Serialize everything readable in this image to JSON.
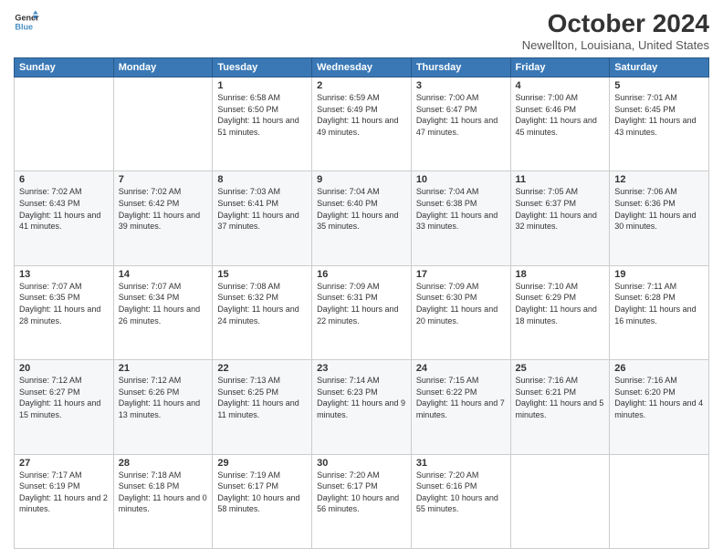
{
  "logo": {
    "line1": "General",
    "line2": "Blue"
  },
  "header": {
    "month": "October 2024",
    "location": "Newellton, Louisiana, United States"
  },
  "weekdays": [
    "Sunday",
    "Monday",
    "Tuesday",
    "Wednesday",
    "Thursday",
    "Friday",
    "Saturday"
  ],
  "weeks": [
    [
      {
        "day": "",
        "info": ""
      },
      {
        "day": "",
        "info": ""
      },
      {
        "day": "1",
        "info": "Sunrise: 6:58 AM\nSunset: 6:50 PM\nDaylight: 11 hours and 51 minutes."
      },
      {
        "day": "2",
        "info": "Sunrise: 6:59 AM\nSunset: 6:49 PM\nDaylight: 11 hours and 49 minutes."
      },
      {
        "day": "3",
        "info": "Sunrise: 7:00 AM\nSunset: 6:47 PM\nDaylight: 11 hours and 47 minutes."
      },
      {
        "day": "4",
        "info": "Sunrise: 7:00 AM\nSunset: 6:46 PM\nDaylight: 11 hours and 45 minutes."
      },
      {
        "day": "5",
        "info": "Sunrise: 7:01 AM\nSunset: 6:45 PM\nDaylight: 11 hours and 43 minutes."
      }
    ],
    [
      {
        "day": "6",
        "info": "Sunrise: 7:02 AM\nSunset: 6:43 PM\nDaylight: 11 hours and 41 minutes."
      },
      {
        "day": "7",
        "info": "Sunrise: 7:02 AM\nSunset: 6:42 PM\nDaylight: 11 hours and 39 minutes."
      },
      {
        "day": "8",
        "info": "Sunrise: 7:03 AM\nSunset: 6:41 PM\nDaylight: 11 hours and 37 minutes."
      },
      {
        "day": "9",
        "info": "Sunrise: 7:04 AM\nSunset: 6:40 PM\nDaylight: 11 hours and 35 minutes."
      },
      {
        "day": "10",
        "info": "Sunrise: 7:04 AM\nSunset: 6:38 PM\nDaylight: 11 hours and 33 minutes."
      },
      {
        "day": "11",
        "info": "Sunrise: 7:05 AM\nSunset: 6:37 PM\nDaylight: 11 hours and 32 minutes."
      },
      {
        "day": "12",
        "info": "Sunrise: 7:06 AM\nSunset: 6:36 PM\nDaylight: 11 hours and 30 minutes."
      }
    ],
    [
      {
        "day": "13",
        "info": "Sunrise: 7:07 AM\nSunset: 6:35 PM\nDaylight: 11 hours and 28 minutes."
      },
      {
        "day": "14",
        "info": "Sunrise: 7:07 AM\nSunset: 6:34 PM\nDaylight: 11 hours and 26 minutes."
      },
      {
        "day": "15",
        "info": "Sunrise: 7:08 AM\nSunset: 6:32 PM\nDaylight: 11 hours and 24 minutes."
      },
      {
        "day": "16",
        "info": "Sunrise: 7:09 AM\nSunset: 6:31 PM\nDaylight: 11 hours and 22 minutes."
      },
      {
        "day": "17",
        "info": "Sunrise: 7:09 AM\nSunset: 6:30 PM\nDaylight: 11 hours and 20 minutes."
      },
      {
        "day": "18",
        "info": "Sunrise: 7:10 AM\nSunset: 6:29 PM\nDaylight: 11 hours and 18 minutes."
      },
      {
        "day": "19",
        "info": "Sunrise: 7:11 AM\nSunset: 6:28 PM\nDaylight: 11 hours and 16 minutes."
      }
    ],
    [
      {
        "day": "20",
        "info": "Sunrise: 7:12 AM\nSunset: 6:27 PM\nDaylight: 11 hours and 15 minutes."
      },
      {
        "day": "21",
        "info": "Sunrise: 7:12 AM\nSunset: 6:26 PM\nDaylight: 11 hours and 13 minutes."
      },
      {
        "day": "22",
        "info": "Sunrise: 7:13 AM\nSunset: 6:25 PM\nDaylight: 11 hours and 11 minutes."
      },
      {
        "day": "23",
        "info": "Sunrise: 7:14 AM\nSunset: 6:23 PM\nDaylight: 11 hours and 9 minutes."
      },
      {
        "day": "24",
        "info": "Sunrise: 7:15 AM\nSunset: 6:22 PM\nDaylight: 11 hours and 7 minutes."
      },
      {
        "day": "25",
        "info": "Sunrise: 7:16 AM\nSunset: 6:21 PM\nDaylight: 11 hours and 5 minutes."
      },
      {
        "day": "26",
        "info": "Sunrise: 7:16 AM\nSunset: 6:20 PM\nDaylight: 11 hours and 4 minutes."
      }
    ],
    [
      {
        "day": "27",
        "info": "Sunrise: 7:17 AM\nSunset: 6:19 PM\nDaylight: 11 hours and 2 minutes."
      },
      {
        "day": "28",
        "info": "Sunrise: 7:18 AM\nSunset: 6:18 PM\nDaylight: 11 hours and 0 minutes."
      },
      {
        "day": "29",
        "info": "Sunrise: 7:19 AM\nSunset: 6:17 PM\nDaylight: 10 hours and 58 minutes."
      },
      {
        "day": "30",
        "info": "Sunrise: 7:20 AM\nSunset: 6:17 PM\nDaylight: 10 hours and 56 minutes."
      },
      {
        "day": "31",
        "info": "Sunrise: 7:20 AM\nSunset: 6:16 PM\nDaylight: 10 hours and 55 minutes."
      },
      {
        "day": "",
        "info": ""
      },
      {
        "day": "",
        "info": ""
      }
    ]
  ]
}
